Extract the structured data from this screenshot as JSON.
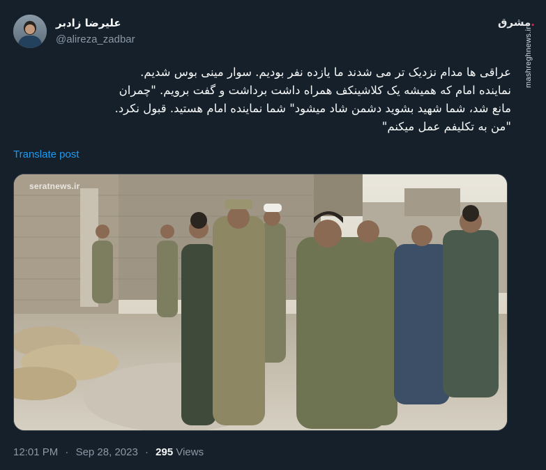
{
  "author": {
    "display_name": "علیرضا زادبر",
    "handle": "@alireza_zadbar"
  },
  "brand": {
    "logo_text": "مشرق",
    "side_url": "mashreghnews.ir"
  },
  "post": {
    "lines": [
      "عراقی ها مدام نزدیک تر می شدند ما یازده نفر بودیم. سوار مینی بوس شدیم.",
      "نماینده امام که همیشه یک کلاشینکف همراه داشت برداشت و گفت برویم. \"چمران",
      "مانع شد، شما شهید بشوید دشمن شاد میشود\" شما نماینده امام هستید. قبول نکرد.",
      "\"من به تکلیفم عمل میکنم\""
    ],
    "translate_label": "Translate post"
  },
  "photo": {
    "watermark": "seratnews.ir"
  },
  "meta": {
    "time": "12:01 PM",
    "dot": "·",
    "date": "Sep 28, 2023",
    "views_count": "295",
    "views_label": "Views"
  },
  "colors": {
    "background": "#15202b",
    "link": "#1d9bf0",
    "muted": "#8b98a5",
    "text": "#f7f9f9"
  }
}
